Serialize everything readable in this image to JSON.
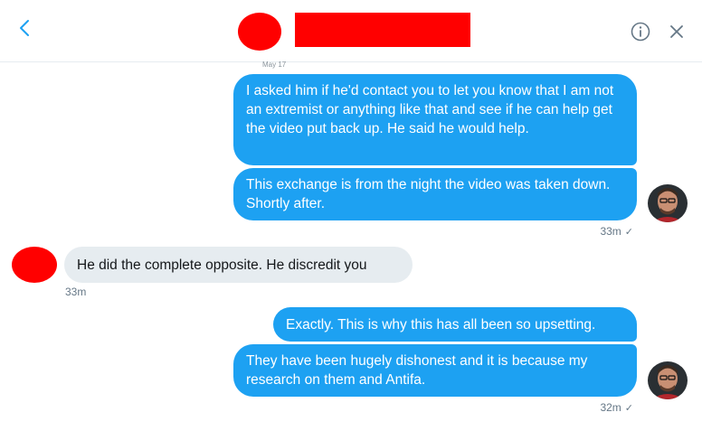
{
  "conversation": {
    "date_label": "May 17",
    "messages": [
      {
        "id": "m1",
        "text": "I asked him if he'd contact you to let you know that I am not an extremist or anything like that and see if he can help get the video put back up. He said he would help."
      },
      {
        "id": "m2",
        "text": "This exchange is from the night the video was taken down. Shortly after."
      },
      {
        "id": "m3",
        "text": "He did the complete opposite. He discredit you"
      },
      {
        "id": "m4",
        "text": "Exactly. This is why this has all been so upsetting."
      },
      {
        "id": "m5",
        "text": "They have been hugely dishonest and it is because my research on them and Antifa."
      }
    ],
    "timestamps": {
      "group1": "33m",
      "group2": "33m",
      "group3": "32m"
    },
    "read_mark": "✓"
  },
  "icons": {
    "back": "chevron-left-icon",
    "info": "info-icon",
    "close": "close-icon"
  },
  "colors": {
    "outgoing_bubble": "#1da1f2",
    "incoming_bubble": "#e6ecf0",
    "redaction": "#ff0000"
  }
}
